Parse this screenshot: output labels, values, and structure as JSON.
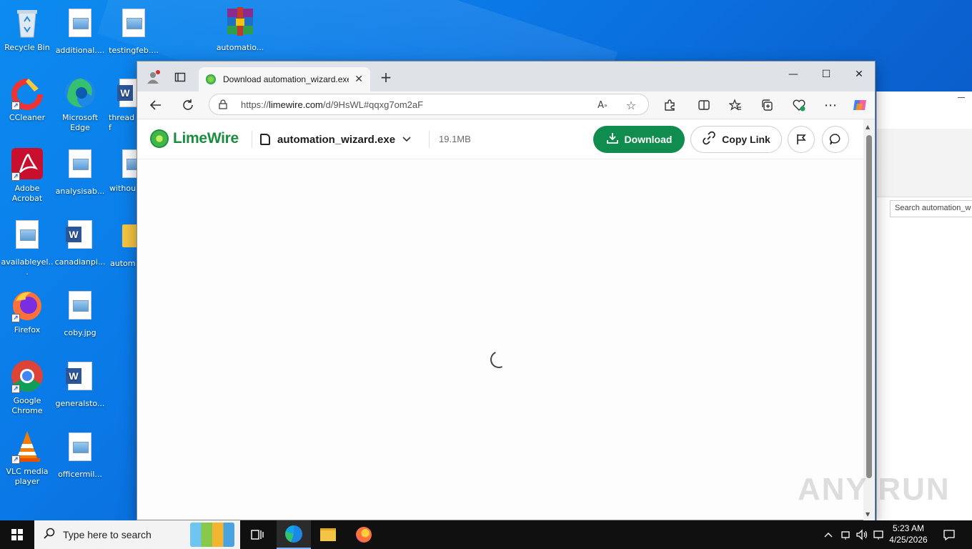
{
  "desktop": {
    "icons": [
      {
        "label": "Recycle Bin"
      },
      {
        "label": "additional...."
      },
      {
        "label": "testingfeb...."
      },
      {
        "label": "automatio..."
      },
      {
        "label": "CCleaner"
      },
      {
        "label": "Microsoft Edge"
      },
      {
        "label": "threadf"
      },
      {
        "label": "Adobe Acrobat"
      },
      {
        "label": "analysisab..."
      },
      {
        "label": "withou"
      },
      {
        "label": "availableyel..."
      },
      {
        "label": "canadianpi..."
      },
      {
        "label": "autom"
      },
      {
        "label": "Firefox"
      },
      {
        "label": "coby.jpg"
      },
      {
        "label": "Google Chrome"
      },
      {
        "label": "generalsto..."
      },
      {
        "label": "VLC media player"
      },
      {
        "label": "officermil..."
      }
    ]
  },
  "background_window": {
    "search_placeholder": "Search automation_w"
  },
  "browser": {
    "tab": {
      "title": "Download automation_wizard.exe",
      "close": "✕"
    },
    "new_tab": "+",
    "window_controls": {
      "minimize": "—",
      "maximize": "☐",
      "close": "✕"
    },
    "address": {
      "scheme": "https://",
      "host": "limewire.com",
      "path": "/d/9HsWL#qqxg7om2aF"
    }
  },
  "page": {
    "brand": "LimeWire",
    "file_name": "automation_wizard.exe",
    "file_size": "19.1MB",
    "download_label": "Download",
    "copy_link_label": "Copy Link"
  },
  "watermark": "ANY RUN",
  "taskbar": {
    "search_placeholder": "Type here to search",
    "time": "5:23 AM",
    "date": "4/25/2026"
  },
  "colors": {
    "limewire_green": "#118c4f",
    "taskbar": "#101010",
    "desktop_blue": "#0a78e6"
  }
}
